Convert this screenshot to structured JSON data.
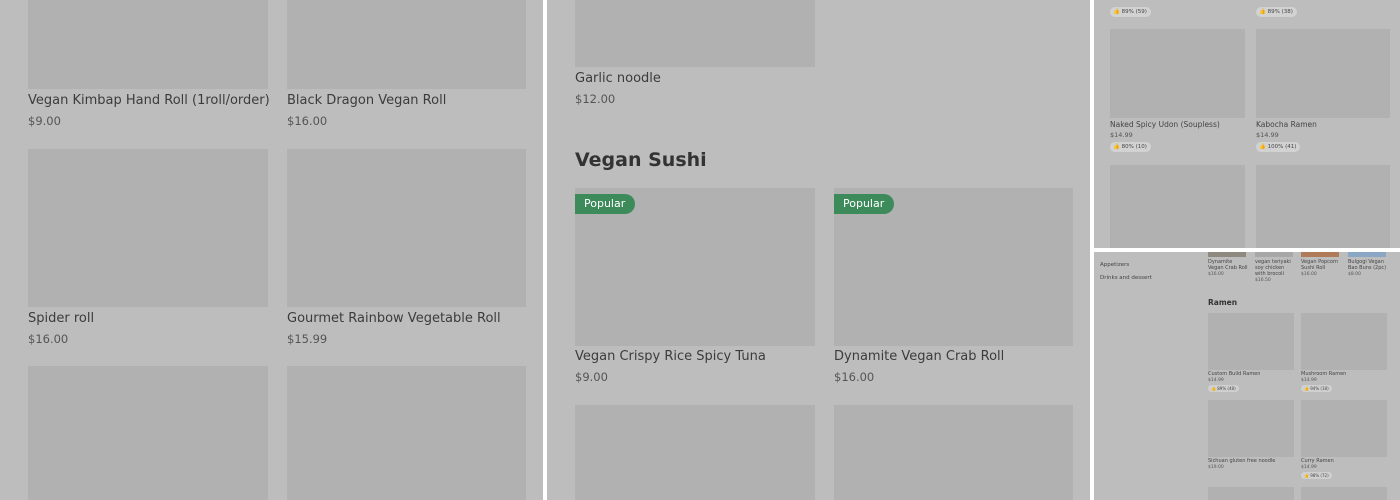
{
  "left_panel": {
    "items": [
      {
        "name": "Vegan Kimbap Hand Roll  (1roll/order)",
        "price": "$9.00"
      },
      {
        "name": "Black Dragon Vegan Roll",
        "price": "$16.00"
      },
      {
        "name": "Spider roll",
        "price": "$16.00"
      },
      {
        "name": "Gourmet Rainbow Vegetable Roll",
        "price": "$15.99"
      }
    ]
  },
  "middle_panel": {
    "top_item": {
      "name": "Garlic noodle",
      "price": "$12.00"
    },
    "section_title": "Vegan Sushi",
    "items": [
      {
        "badge": "Popular",
        "name": "Vegan Crispy Rice Spicy Tuna",
        "price": "$9.00"
      },
      {
        "badge": "Popular",
        "name": "Dynamite Vegan Crab Roll",
        "price": "$16.00"
      }
    ]
  },
  "top_right_panel": {
    "top_ratings": [
      "89% (59)",
      "89% (38)"
    ],
    "items": [
      {
        "name": "Naked Spicy Udon (Soupless)",
        "price": "$14.99",
        "rating": "80% (10)"
      },
      {
        "name": "Kabocha Ramen",
        "price": "$14.99",
        "rating": "100% (41)"
      }
    ]
  },
  "bottom_right_panel": {
    "categories": [
      "Appetizers",
      "Drinks and dessert"
    ],
    "strip": [
      {
        "name": "Dynamite Vegan Crab Roll",
        "price": "$16.00"
      },
      {
        "name": "vegan teriyaki soy chicken with brocoli",
        "price": "$16.50"
      },
      {
        "name": "Vegan Popcorn Sushi Roll",
        "price": "$16.00"
      },
      {
        "name": "Bulgogi Vegan Bao Buns (2pc)",
        "price": "$8.00"
      }
    ],
    "section_title": "Ramen",
    "items": [
      {
        "name": "Custom Build Ramen",
        "price": "$14.99",
        "rating": "89% (48)"
      },
      {
        "name": "Mushroom Ramen",
        "price": "$14.99",
        "rating": "94% (18)"
      },
      {
        "name": "Sichuan gluten free noodle",
        "price": "$19.00"
      },
      {
        "name": "Curry Ramen",
        "price": "$14.99",
        "rating": "98% (72)"
      }
    ]
  },
  "icons": {
    "rating": "thumbs-up-icon"
  }
}
